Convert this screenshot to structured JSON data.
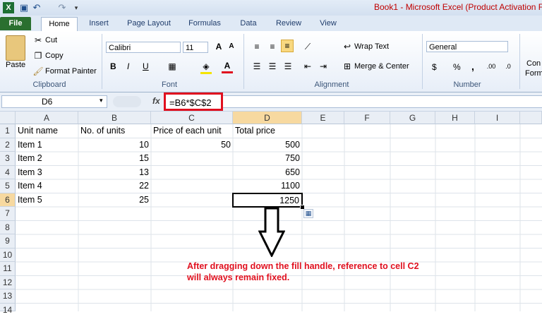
{
  "window": {
    "title": "Book1  -  Microsoft Excel (Product Activation Fa"
  },
  "tabs": [
    "File",
    "Home",
    "Insert",
    "Page Layout",
    "Formulas",
    "Data",
    "Review",
    "View"
  ],
  "clipboard": {
    "paste": "Paste",
    "cut": "Cut",
    "copy": "Copy",
    "format_painter": "Format Painter",
    "label": "Clipboard"
  },
  "font": {
    "family": "Calibri",
    "size": "11",
    "bold": "B",
    "italic": "I",
    "underline": "U",
    "label": "Font"
  },
  "alignment": {
    "wrap": "Wrap Text",
    "merge": "Merge & Center",
    "label": "Alignment"
  },
  "number": {
    "format": "General",
    "currency": "$",
    "percent": "%",
    "comma": ",",
    "label": "Number"
  },
  "conditional": {
    "line1": "Con",
    "line2": "Form"
  },
  "formula_bar": {
    "name_box": "D6",
    "fx": "fx",
    "formula": "=B6*$C$2"
  },
  "columns": [
    "A",
    "B",
    "C",
    "D",
    "E",
    "F",
    "G",
    "H",
    "I"
  ],
  "rows": [
    "1",
    "2",
    "3",
    "4",
    "5",
    "6",
    "7",
    "8",
    "9",
    "10",
    "11",
    "12",
    "13",
    "14"
  ],
  "table": {
    "header": [
      "Unit name",
      "No. of units",
      "Price of each unit",
      "Total price"
    ],
    "data": [
      [
        "Item 1",
        "10",
        "50",
        "500"
      ],
      [
        "Item 2",
        "15",
        "",
        "750"
      ],
      [
        "Item 3",
        "13",
        "",
        "650"
      ],
      [
        "Item 4",
        "22",
        "",
        "1100"
      ],
      [
        "Item 5",
        "25",
        "",
        "1250"
      ]
    ]
  },
  "annotation": {
    "line1": "After dragging down the fill handle, reference to cell C2",
    "line2": "will always remain fixed.",
    "color": "#e0101f"
  },
  "colors": {
    "selection": "#f7d9a0",
    "file_tab": "#2a6f2f",
    "highlight": "#e0101f"
  }
}
